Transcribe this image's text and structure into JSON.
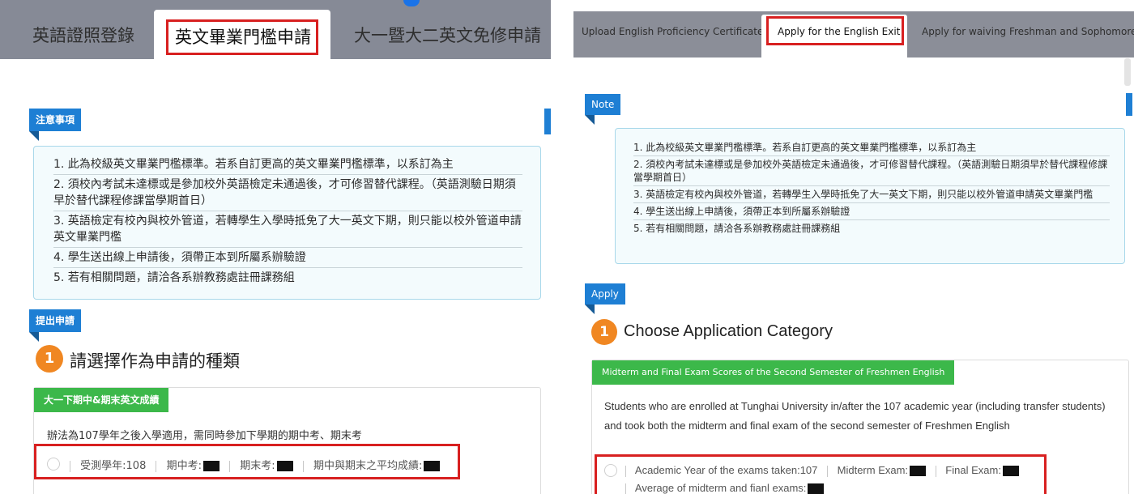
{
  "left": {
    "tabs": [
      {
        "label": "英語證照登錄"
      },
      {
        "label": "英文畢業門檻申請"
      },
      {
        "label": "大一暨大二英文免修申請"
      }
    ],
    "note_header": "注意事項",
    "notes": [
      "1. 此為校級英文畢業門檻標準。若系自訂更高的英文畢業門檻標準，以系訂為主",
      "2. 須校內考試未達標或是參加校外英語檢定未通過後，才可修習替代課程。（英語測驗日期須早於替代課程修課當學期首日）",
      "3. 英語檢定有校內與校外管道，若轉學生入學時抵免了大一英文下期，則只能以校外管道申請英文畢業門檻",
      "4. 學生送出線上申請後，須帶正本到所屬系辦驗證",
      "5. 若有相關問題，請洽各系辦教務處註冊課務組"
    ],
    "apply_header": "提出申請",
    "step_number": "1",
    "step_title": "請選擇作為申請的種類",
    "category_label": "大一下期中&期末英文成績",
    "category_desc": "辦法為107學年之後入學適用，需同時參加下學期的期中考、期末考",
    "option_parts": [
      "受測學年:108",
      "期中考:",
      "期末考:",
      "期中與期末之平均成績:"
    ]
  },
  "right": {
    "tabs": [
      {
        "label": "Upload English Proficiency Certificate"
      },
      {
        "label": "Apply for the English Exit"
      },
      {
        "label": "Apply for waiving Freshman and Sophomore E"
      }
    ],
    "note_header": "Note",
    "notes": [
      "1. 此為校級英文畢業門檻標準。若系自訂更高的英文畢業門檻標準，以系訂為主",
      "2. 須校內考試未達標或是參加校外英語檢定未通過後，才可修習替代課程。（英語測驗日期須早於替代課程修課當學期首日）",
      "3. 英語檢定有校內與校外管道，若轉學生入學時抵免了大一英文下期，則只能以校外管道申請英文畢業門檻",
      "4. 學生送出線上申請後，須帶正本到所屬系辦驗證",
      "5. 若有相關問題，請洽各系辦教務處註冊課務組"
    ],
    "apply_header": "Apply",
    "step_number": "1",
    "step_title": "Choose Application Category",
    "category_label": "Midterm and Final Exam Scores of the Second Semester of Freshmen English",
    "category_desc": "Students who are enrolled at Tunghai University in/after the 107 academic year (including transfer students) and took both the midterm and final exam of the second semester of Freshmen English",
    "option_parts": [
      "Academic Year of the exams taken:107",
      "Midterm Exam:",
      "Final Exam:",
      "Average of midterm and fianl exams:"
    ]
  },
  "colors": {
    "accent_blue": "#1e7fd4",
    "category_green": "#3cb84a",
    "step_orange": "#f08722",
    "highlight_red": "#d82020",
    "tab_bar_gray": "#868a96"
  }
}
